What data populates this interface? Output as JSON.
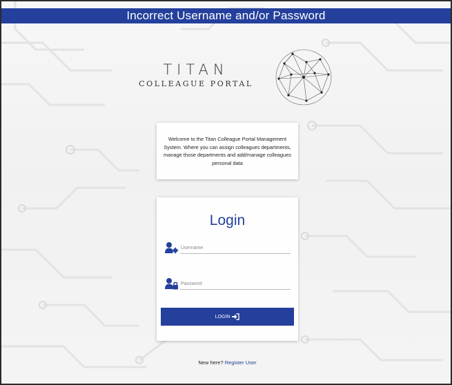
{
  "alert": {
    "message": "Incorrect Username and/or Password"
  },
  "logo": {
    "title": "TITAN",
    "subtitle": "COLLEAGUE PORTAL"
  },
  "welcome": {
    "text": "Welcome to the Titan Colleague Portal Management System. Where you can assign colleagues departments, manage those departments and add/manage colleagues personal data"
  },
  "login": {
    "title": "Login",
    "username_placeholder": "Username",
    "password_placeholder": "Password",
    "button_label": "LOGIN"
  },
  "register": {
    "prompt": "New here?",
    "link_label": "Register User"
  },
  "colors": {
    "accent": "#24409c",
    "background": "#f4f4f4"
  },
  "icons": [
    "user-gear-icon",
    "user-lock-icon",
    "sign-in-icon",
    "globe-logo-icon"
  ]
}
